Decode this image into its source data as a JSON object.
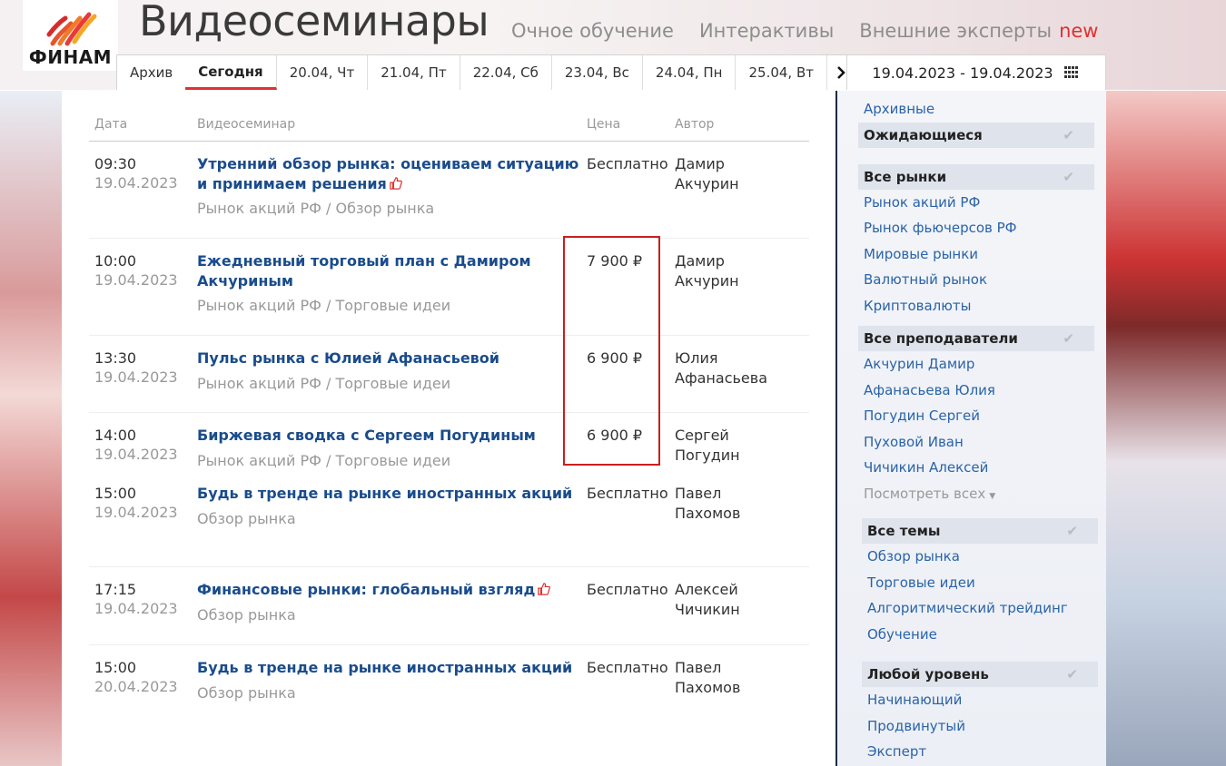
{
  "brand": {
    "logo_text": "ФИНАМ"
  },
  "header": {
    "title": "Видеосеминары",
    "nav": [
      "Очное обучение",
      "Интерактивы",
      "Внешние эксперты"
    ],
    "nav_badge": "new"
  },
  "tabs": {
    "archive": "Архив",
    "items": [
      "Сегодня",
      "20.04, Чт",
      "21.04, Пт",
      "22.04, Сб",
      "23.04, Вс",
      "24.04, Пн",
      "25.04, Вт"
    ],
    "active_index": 0,
    "next_arrow": "›"
  },
  "date_range": "19.04.2023 - 19.04.2023",
  "table": {
    "headers": {
      "date": "Дата",
      "seminar": "Видеосеминар",
      "price": "Цена",
      "author": "Автор"
    },
    "rows": [
      {
        "time": "09:30",
        "date": "19.04.2023",
        "title": "Утренний обзор рынка: оцениваем ситуацию и принимаем решения",
        "liked": true,
        "category": "Рынок акций РФ / Обзор рынка",
        "price": "Бесплатно",
        "author": "Дамир Акчурин"
      },
      {
        "time": "10:00",
        "date": "19.04.2023",
        "title": "Ежедневный торговый план с Дамиром Акчуриным",
        "liked": false,
        "category": "Рынок акций РФ / Торговые идеи",
        "price": "7 900 ₽",
        "author": "Дамир Акчурин"
      },
      {
        "time": "13:30",
        "date": "19.04.2023",
        "title": "Пульс рынка с Юлией Афанасьевой",
        "liked": false,
        "category": "Рынок акций РФ / Торговые идеи",
        "price": "6 900 ₽",
        "author": "Юлия Афанасьева"
      },
      {
        "time": "14:00",
        "date": "19.04.2023",
        "title": "Биржевая сводка с Сергеем Погудиным",
        "liked": false,
        "category": "Рынок акций РФ / Торговые идеи",
        "price": "6 900 ₽",
        "author": "Сергей Погудин"
      },
      {
        "time": "15:00",
        "date": "19.04.2023",
        "title": "Будь в тренде на рынке иностранных акций",
        "liked": false,
        "category": "Обзор рынка",
        "price": "Бесплатно",
        "author": "Павел Пахомов"
      },
      {
        "time": "17:15",
        "date": "19.04.2023",
        "title": "Финансовые рынки: глобальный взгляд",
        "liked": true,
        "category": "Обзор рынка",
        "price": "Бесплатно",
        "author": "Алексей Чичикин"
      },
      {
        "time": "15:00",
        "date": "20.04.2023",
        "title": "Будь в тренде на рынке иностранных акций",
        "liked": false,
        "category": "Обзор рынка",
        "price": "Бесплатно",
        "author": "Павел Пахомов"
      }
    ]
  },
  "sidebar": {
    "archive_link": "Архивные",
    "status_head": "Ожидающиеся",
    "markets_head": "Все рынки",
    "markets": [
      "Рынок акций РФ",
      "Рынок фьючерсов РФ",
      "Мировые рынки",
      "Валютный рынок",
      "Криптовалюты"
    ],
    "teachers_head": "Все преподаватели",
    "teachers": [
      "Акчурин Дамир",
      "Афанасьева Юлия",
      "Погудин Сергей",
      "Пуховой Иван",
      "Чичикин Алексей"
    ],
    "see_all": "Посмотреть всех",
    "topics_head": "Все темы",
    "topics": [
      "Обзор рынка",
      "Торговые идеи",
      "Алгоритмический трейдинг",
      "Обучение"
    ],
    "level_head": "Любой уровень",
    "levels": [
      "Начинающий",
      "Продвинутый",
      "Эксперт"
    ]
  },
  "colors": {
    "accent": "#e03030",
    "link": "#1a4c8c",
    "highlight_box": "#cc1f1f"
  }
}
